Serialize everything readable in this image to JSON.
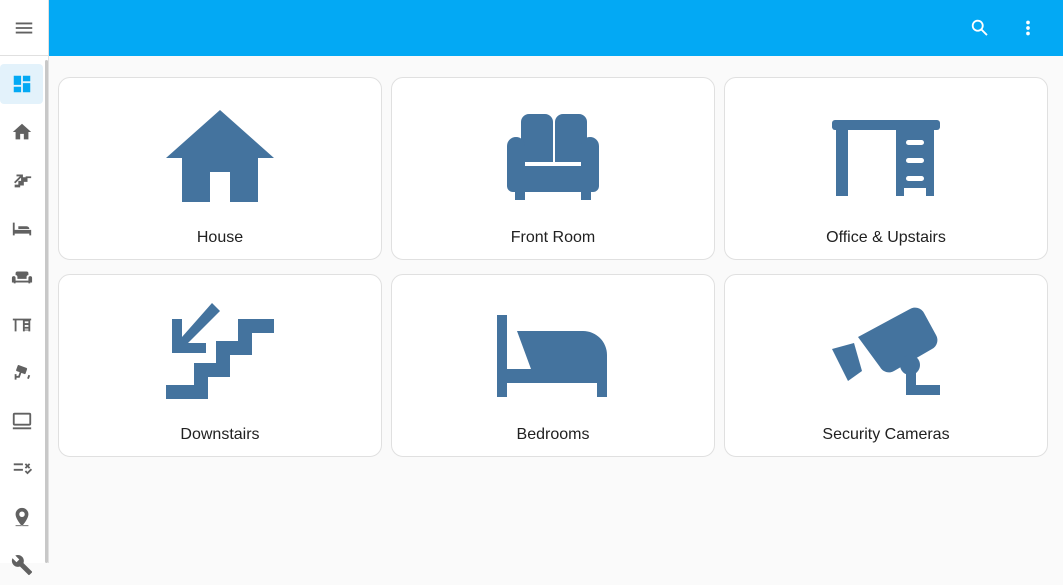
{
  "header": {
    "background_color": "#03a9f4",
    "search_icon": "search-icon",
    "overflow_icon": "dots-vertical-icon"
  },
  "sidebar": {
    "menu_icon": "menu-icon",
    "items": [
      {
        "icon": "view-dashboard-icon",
        "active": true
      },
      {
        "icon": "home-icon",
        "active": false
      },
      {
        "icon": "stairs-down-icon",
        "active": false
      },
      {
        "icon": "bed-icon",
        "active": false
      },
      {
        "icon": "sofa-icon",
        "active": false
      },
      {
        "icon": "desk-icon",
        "active": false
      },
      {
        "icon": "cctv-icon",
        "active": false
      },
      {
        "icon": "laptop-icon",
        "active": false
      },
      {
        "icon": "format-list-checks-icon",
        "active": false
      },
      {
        "icon": "map-marker-icon",
        "active": false
      }
    ]
  },
  "cards": [
    {
      "label": "House",
      "icon": "home-icon"
    },
    {
      "label": "Front Room",
      "icon": "sofa-icon"
    },
    {
      "label": "Office & Upstairs",
      "icon": "desk-icon"
    },
    {
      "label": "Downstairs",
      "icon": "stairs-down-icon"
    },
    {
      "label": "Bedrooms",
      "icon": "bed-icon"
    },
    {
      "label": "Security Cameras",
      "icon": "cctv-icon"
    }
  ],
  "colors": {
    "icon_primary": "#44739e",
    "sidebar_icon": "#616161",
    "active_icon": "#03a9f4"
  }
}
